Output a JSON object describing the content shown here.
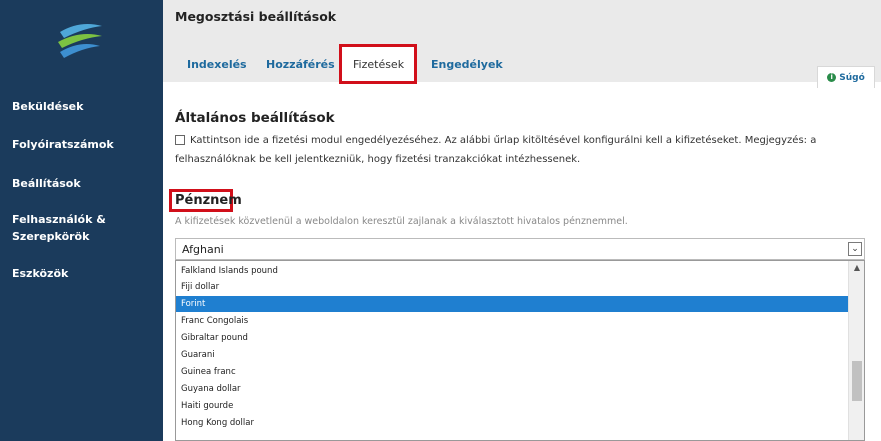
{
  "sidebar": {
    "items": [
      {
        "label": "Beküldések"
      },
      {
        "label": "Folyóiratszámok"
      },
      {
        "label": "Beállítások"
      },
      {
        "label": "Felhasználók & Szerepkörök"
      },
      {
        "label": "Eszközök"
      }
    ]
  },
  "header": {
    "title": "Megosztási beállítások",
    "tabs": [
      {
        "label": "Indexelés"
      },
      {
        "label": "Hozzáférés"
      },
      {
        "label": "Fizetések"
      },
      {
        "label": "Engedélyek"
      }
    ],
    "help_label": "Súgó"
  },
  "general": {
    "title": "Általános beállítások",
    "checkbox_text": "Kattintson ide a fizetési modul engedélyezéséhez. Az alábbi űrlap kitöltésével konfigurálni kell a kifizetéseket. Megjegyzés: a felhasználóknak be kell jelentkezniük, hogy fizetési tranzakciókat intézhessenek."
  },
  "currency": {
    "title": "Pénznem",
    "description": "A kifizetések közvetlenül a weboldalon keresztül zajlanak a kiválasztott hivatalos pénznemmel.",
    "selected": "Afghani",
    "options": [
      "Falkland Islands pound",
      "Fiji dollar",
      "Forint",
      "Franc Congolais",
      "Gibraltar pound",
      "Guarani",
      "Guinea franc",
      "Guyana dollar",
      "Haiti gourde",
      "Hong Kong dollar"
    ],
    "highlighted": "Forint"
  },
  "colors": {
    "sidebar_bg": "#1b3b5c",
    "highlight_red": "#d10f1a",
    "link_blue": "#1e6a9e",
    "selection_blue": "#1f7fd0"
  }
}
